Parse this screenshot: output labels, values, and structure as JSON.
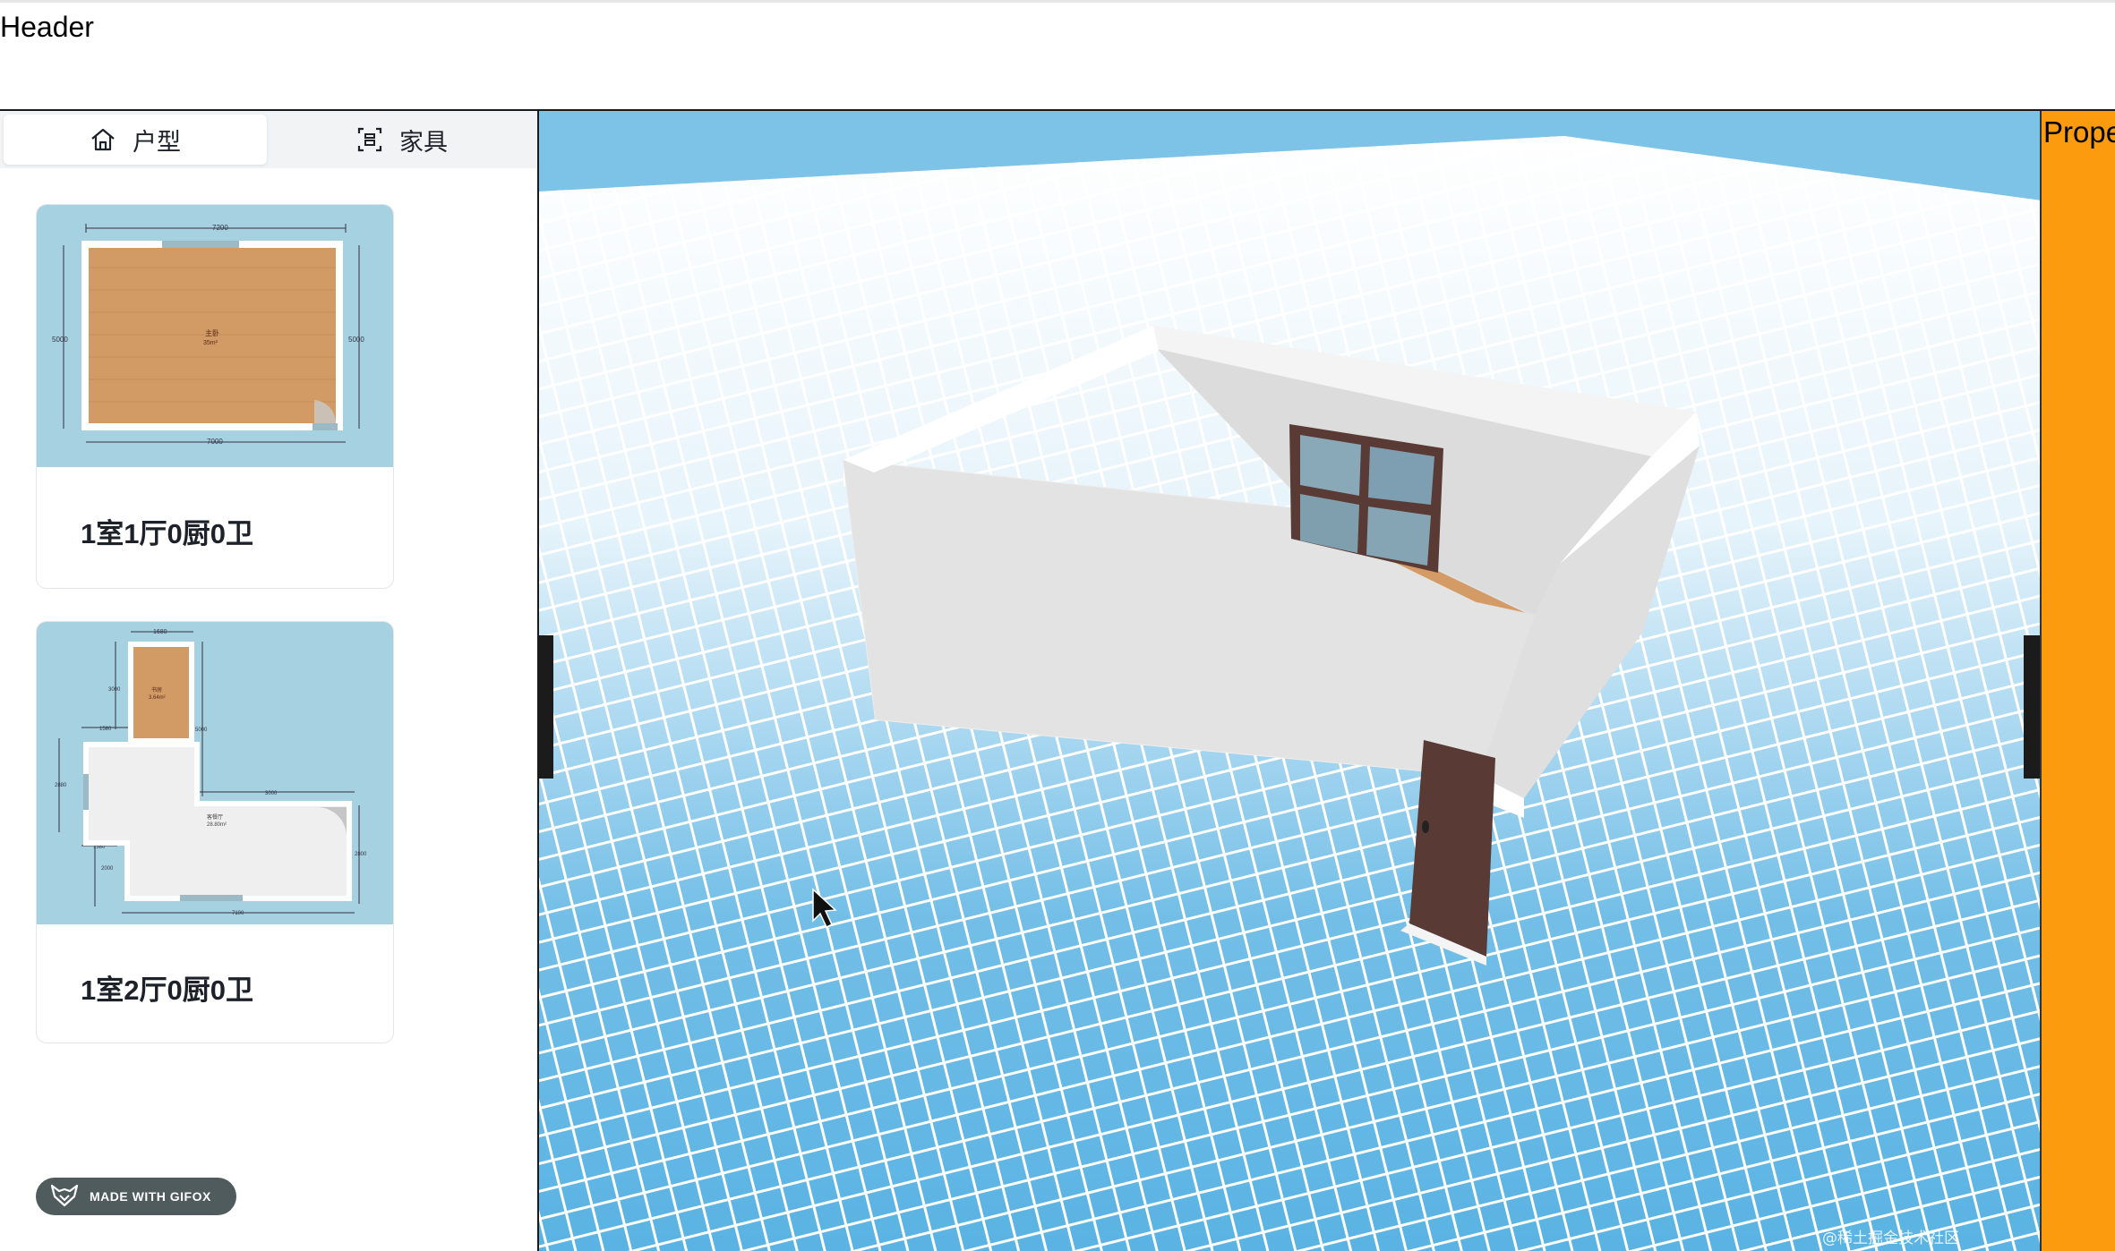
{
  "header": {
    "title": "Header"
  },
  "sidebar": {
    "tabs": [
      {
        "label": "户型",
        "icon": "home-icon",
        "active": true
      },
      {
        "label": "家具",
        "icon": "furniture-icon",
        "active": false
      }
    ],
    "layouts": [
      {
        "name": "1室1厅0厨0卫",
        "plan_top_dim": "7200",
        "plan_bottom_dim": "7000",
        "plan_left_dim": "5000",
        "plan_right_dim": "5000",
        "plan_room_label": "主卧",
        "plan_room_area": "35m²"
      },
      {
        "name": "1室2厅0厨0卫",
        "plan_top_dim": "1680",
        "plan_dim_a": "3000",
        "plan_dim_b": "5000",
        "plan_dim_c": "1580",
        "plan_dim_d": "3000",
        "plan_dim_e": "2880",
        "plan_dim_f": "1380",
        "plan_dim_g": "2000",
        "plan_dim_h": "2800",
        "plan_bottom_dim": "7100",
        "plan_room1_label": "书房",
        "plan_room1_area": "3.64m²",
        "plan_room2_label": "客餐厅",
        "plan_room2_area": "28.80m²"
      }
    ],
    "badge": "MADE WITH GIFOX"
  },
  "viewport": {
    "watermark": "@稀土掘金技术社区"
  },
  "properties": {
    "title": "Properties"
  },
  "colors": {
    "sky": "#7cc3e7",
    "floor_grid": "#58b0e2",
    "wall": "#e2e2e2",
    "wood_floor": "#d59b66",
    "door": "#5a3a34",
    "properties_bg": "#fb9b0d",
    "thumb_bg": "#a5d1e1"
  }
}
